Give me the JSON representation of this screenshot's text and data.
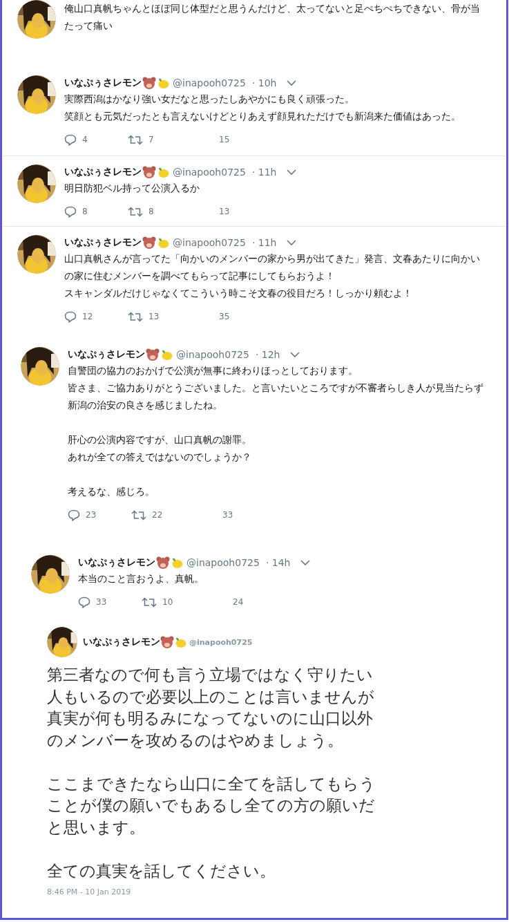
{
  "tweets": [
    {
      "text": [
        [
          "俺山口真帆ちゃんとほぼ同じ体型だと思うんだけど、太ってないと足ぺちぺちできない、骨が当たって痛い"
        ]
      ]
    },
    {
      "name": "いなぷぅさレモン",
      "handle": "@inapooh0725",
      "time": "· 10h",
      "text": [
        [
          "実際西潟はかなり強い女だなと思ったしあやかにも良く頑張った。",
          "笑顔とも元気だったとも言えないけどとりあえず顔見れただけでも新潟来た価値はあった。"
        ]
      ],
      "replies": "4",
      "retweets": "7",
      "likes": "15"
    },
    {
      "name": "いなぷぅさレモン",
      "handle": "@inapooh0725",
      "time": "· 11h",
      "text": [
        [
          "明日防犯ベル持って公演入るか"
        ]
      ],
      "replies": "8",
      "retweets": "8",
      "likes": "13"
    },
    {
      "name": "いなぷぅさレモン",
      "handle": "@inapooh0725",
      "time": "· 11h",
      "text": [
        [
          "山口真帆さんが言ってた「向かいのメンバーの家から男が出てきた」発言、文春あたりに向かいの家に住むメンバーを調べてもらって記事にしてもらおうよ！",
          "スキャンダルだけじゃなくてこういう時こそ文春の役目だろ！しっかり頼むよ！"
        ]
      ],
      "replies": "12",
      "retweets": "13",
      "likes": "35"
    },
    {
      "name": "いなぷぅさレモン",
      "handle": "@inapooh0725",
      "time": "· 12h",
      "text": [
        [
          "自警団の協力のおかげで公演が無事に終わりほっとしております。",
          "皆さま、ご協力ありがとうございました。と言いたいところですが不審者らしき人が見当たらず新潟の治安の良さを感じましたね。"
        ],
        [
          "肝心の公演内容ですが、山口真帆の謝罪。",
          "あれが全ての答えではないのでしょうか？"
        ],
        [
          "考えるな、感じろ。"
        ]
      ],
      "replies": "23",
      "retweets": "22",
      "likes": "33"
    },
    {
      "name": "いなぷぅさレモン",
      "handle": "@inapooh0725",
      "time": "· 14h",
      "text": [
        [
          "本当のこと言おうよ、真帆。"
        ]
      ],
      "replies": "33",
      "retweets": "10",
      "likes": "24"
    }
  ],
  "detail": {
    "name": "いなぷぅさレモン",
    "handle": "@inapooh0725",
    "text": [
      "第三者なので何も言う立場ではなく守りたい人もいるので必要以上のことは言いませんが真実が何も明るみになってないのに山口以外のメンバーを攻めるのはやめましょう。",
      "ここまできたなら山口に全てを話してもらうことが僕の願いでもあるし全ての方の願いだと思います。",
      "全ての真実を話してください。"
    ],
    "timestamp": "8:46 PM - 10 Jan 2019"
  }
}
